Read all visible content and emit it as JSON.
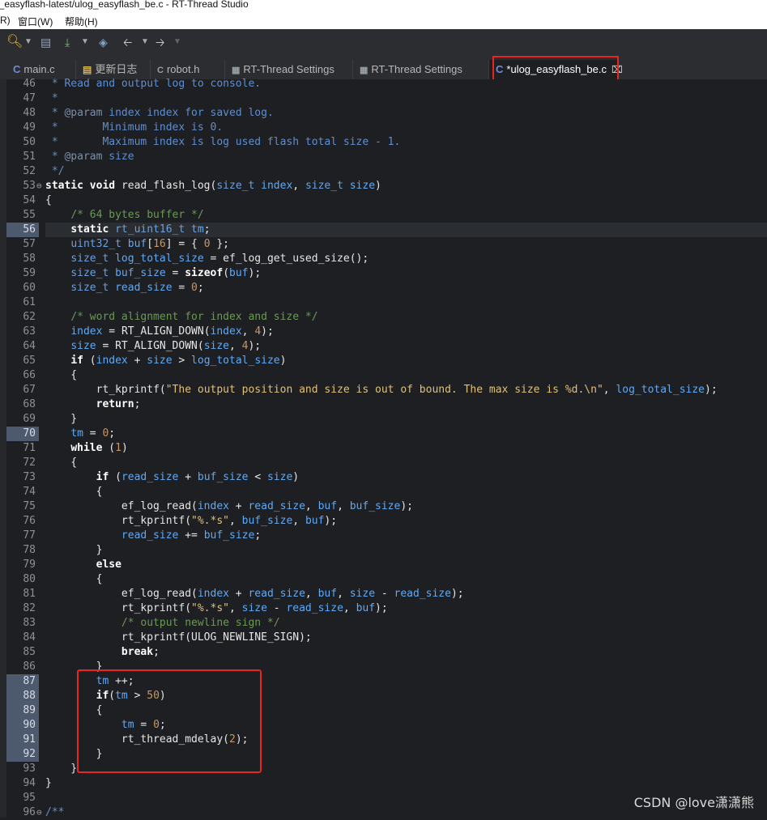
{
  "window": {
    "title": "g_easyflash-latest/ulog_easyflash_be.c - RT-Thread Studio"
  },
  "menu": {
    "partial": "R)",
    "window": "窗口(W)",
    "help": "帮助(H)"
  },
  "tabs": [
    {
      "label": "main.c",
      "icon": "c-file-icon"
    },
    {
      "label": "更新日志",
      "icon": "document-icon"
    },
    {
      "label": "robot.h",
      "icon": "c-header-icon"
    },
    {
      "label": "RT-Thread Settings",
      "icon": "settings-icon"
    },
    {
      "label": "RT-Thread Settings",
      "icon": "settings-icon"
    },
    {
      "label": "*ulog_easyflash_be.c",
      "icon": "c-file-icon",
      "active": true
    }
  ],
  "editor": {
    "current_line": 56,
    "changed_lines": [
      56,
      70,
      87,
      88,
      89,
      90,
      91,
      92
    ],
    "lines": [
      {
        "n": "46",
        "text": " * Read and output log to console."
      },
      {
        "n": "47",
        "text": " *"
      },
      {
        "n": "48",
        "text": " * @param index index for saved log."
      },
      {
        "n": "49",
        "text": " *       Minimum index is 0."
      },
      {
        "n": "50",
        "text": " *       Maximum index is log used flash total size - 1."
      },
      {
        "n": "51",
        "text": " * @param size"
      },
      {
        "n": "52",
        "text": " */"
      },
      {
        "n": "53",
        "text": "static void read_flash_log(size_t index, size_t size)"
      },
      {
        "n": "54",
        "text": "{"
      },
      {
        "n": "55",
        "text": "    /* 64 bytes buffer */"
      },
      {
        "n": "56",
        "text": "    static rt_uint16_t tm;"
      },
      {
        "n": "57",
        "text": "    uint32_t buf[16] = { 0 };"
      },
      {
        "n": "58",
        "text": "    size_t log_total_size = ef_log_get_used_size();"
      },
      {
        "n": "59",
        "text": "    size_t buf_size = sizeof(buf);"
      },
      {
        "n": "60",
        "text": "    size_t read_size = 0;"
      },
      {
        "n": "61",
        "text": ""
      },
      {
        "n": "62",
        "text": "    /* word alignment for index and size */"
      },
      {
        "n": "63",
        "text": "    index = RT_ALIGN_DOWN(index, 4);"
      },
      {
        "n": "64",
        "text": "    size = RT_ALIGN_DOWN(size, 4);"
      },
      {
        "n": "65",
        "text": "    if (index + size > log_total_size)"
      },
      {
        "n": "66",
        "text": "    {"
      },
      {
        "n": "67",
        "text": "        rt_kprintf(\"The output position and size is out of bound. The max size is %d.\\n\", log_total_size);"
      },
      {
        "n": "68",
        "text": "        return;"
      },
      {
        "n": "69",
        "text": "    }"
      },
      {
        "n": "70",
        "text": "    tm = 0;"
      },
      {
        "n": "71",
        "text": "    while (1)"
      },
      {
        "n": "72",
        "text": "    {"
      },
      {
        "n": "73",
        "text": "        if (read_size + buf_size < size)"
      },
      {
        "n": "74",
        "text": "        {"
      },
      {
        "n": "75",
        "text": "            ef_log_read(index + read_size, buf, buf_size);"
      },
      {
        "n": "76",
        "text": "            rt_kprintf(\"%.*s\", buf_size, buf);"
      },
      {
        "n": "77",
        "text": "            read_size += buf_size;"
      },
      {
        "n": "78",
        "text": "        }"
      },
      {
        "n": "79",
        "text": "        else"
      },
      {
        "n": "80",
        "text": "        {"
      },
      {
        "n": "81",
        "text": "            ef_log_read(index + read_size, buf, size - read_size);"
      },
      {
        "n": "82",
        "text": "            rt_kprintf(\"%.*s\", size - read_size, buf);"
      },
      {
        "n": "83",
        "text": "            /* output newline sign */"
      },
      {
        "n": "84",
        "text": "            rt_kprintf(ULOG_NEWLINE_SIGN);"
      },
      {
        "n": "85",
        "text": "            break;"
      },
      {
        "n": "86",
        "text": "        }"
      },
      {
        "n": "87",
        "text": "        tm ++;"
      },
      {
        "n": "88",
        "text": "        if(tm > 50)"
      },
      {
        "n": "89",
        "text": "        {"
      },
      {
        "n": "90",
        "text": "            tm = 0;"
      },
      {
        "n": "91",
        "text": "            rt_thread_mdelay(2);"
      },
      {
        "n": "92",
        "text": "        }"
      },
      {
        "n": "93",
        "text": "    }"
      },
      {
        "n": "94",
        "text": "}"
      },
      {
        "n": "95",
        "text": ""
      },
      {
        "n": "96",
        "text": "/**"
      }
    ]
  },
  "watermark": "CSDN @love潇潇熊",
  "colors": {
    "highlight_box": "#e8251f",
    "background": "#1e1f22"
  }
}
